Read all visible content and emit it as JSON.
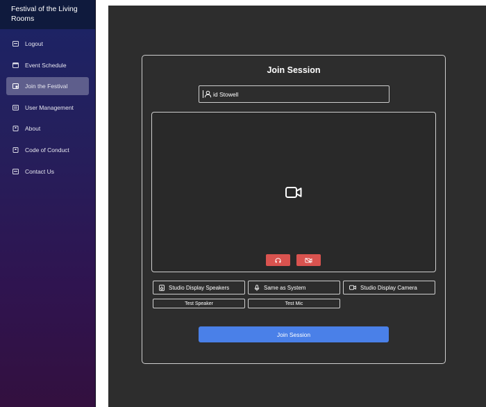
{
  "sidebar": {
    "brand": "Festival of the Living Rooms",
    "items": [
      {
        "label": "Logout",
        "icon": "logout-icon"
      },
      {
        "label": "Event Schedule",
        "icon": "calendar-icon"
      },
      {
        "label": "Join the Festival",
        "icon": "join-icon",
        "active": true
      },
      {
        "label": "User Management",
        "icon": "users-icon"
      },
      {
        "label": "About",
        "icon": "info-icon"
      },
      {
        "label": "Code of Conduct",
        "icon": "document-icon"
      },
      {
        "label": "Contact Us",
        "icon": "mail-icon"
      }
    ]
  },
  "session": {
    "title": "Join Session",
    "name_value": "id Stowell",
    "speakers_label": "Studio Display Speakers",
    "mic_label": "Same as System",
    "camera_label": "Studio Display Camera",
    "test_speaker_label": "Test Speaker",
    "test_mic_label": "Test Mic",
    "join_label": "Join Session"
  },
  "colors": {
    "accent": "#4a80e8",
    "danger": "#d9534f",
    "panel": "#2d2d2d"
  }
}
